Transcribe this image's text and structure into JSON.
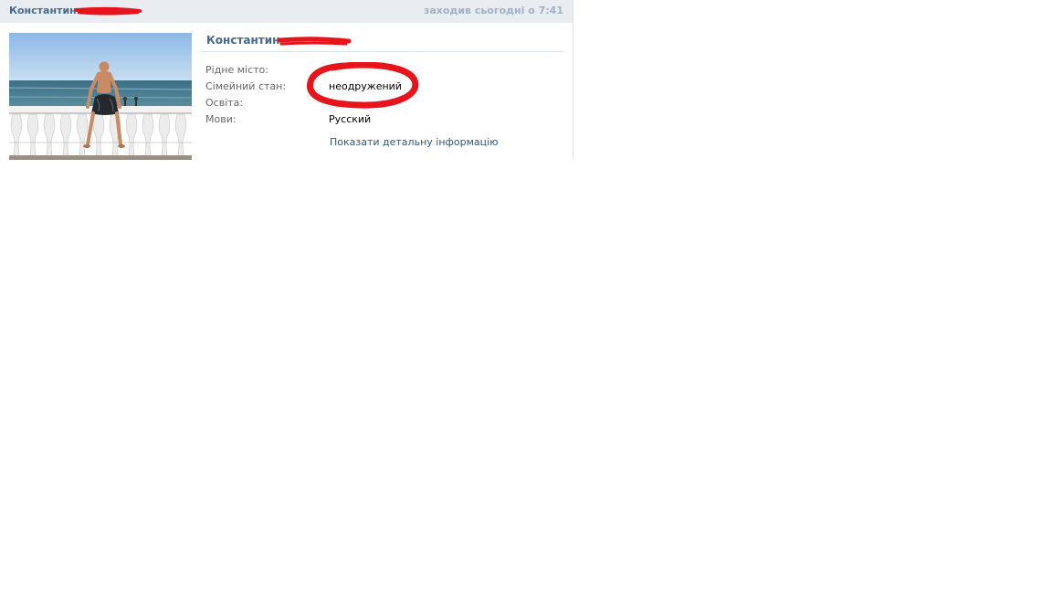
{
  "header": {
    "name": "Константин",
    "last_seen": "заходив сьогодні о 7:41"
  },
  "profile": {
    "name": "Константин",
    "fields": [
      {
        "label": "Рідне місто:",
        "value": ""
      },
      {
        "label": "Сімейний стан:",
        "value": "неодружений"
      },
      {
        "label": "Освіта:",
        "value": ""
      },
      {
        "label": "Мови:",
        "value": "Русский"
      }
    ],
    "details_link": "Показати детальну інформацію"
  },
  "colors": {
    "header_bg": "#e9edf1",
    "name_blue": "#45688e",
    "link_blue": "#2b587a",
    "redaction_red": "#e8141c"
  },
  "icons": {
    "photo": "profile-photo",
    "redaction": "red-scribble-redaction",
    "highlight": "red-circle-highlight"
  }
}
